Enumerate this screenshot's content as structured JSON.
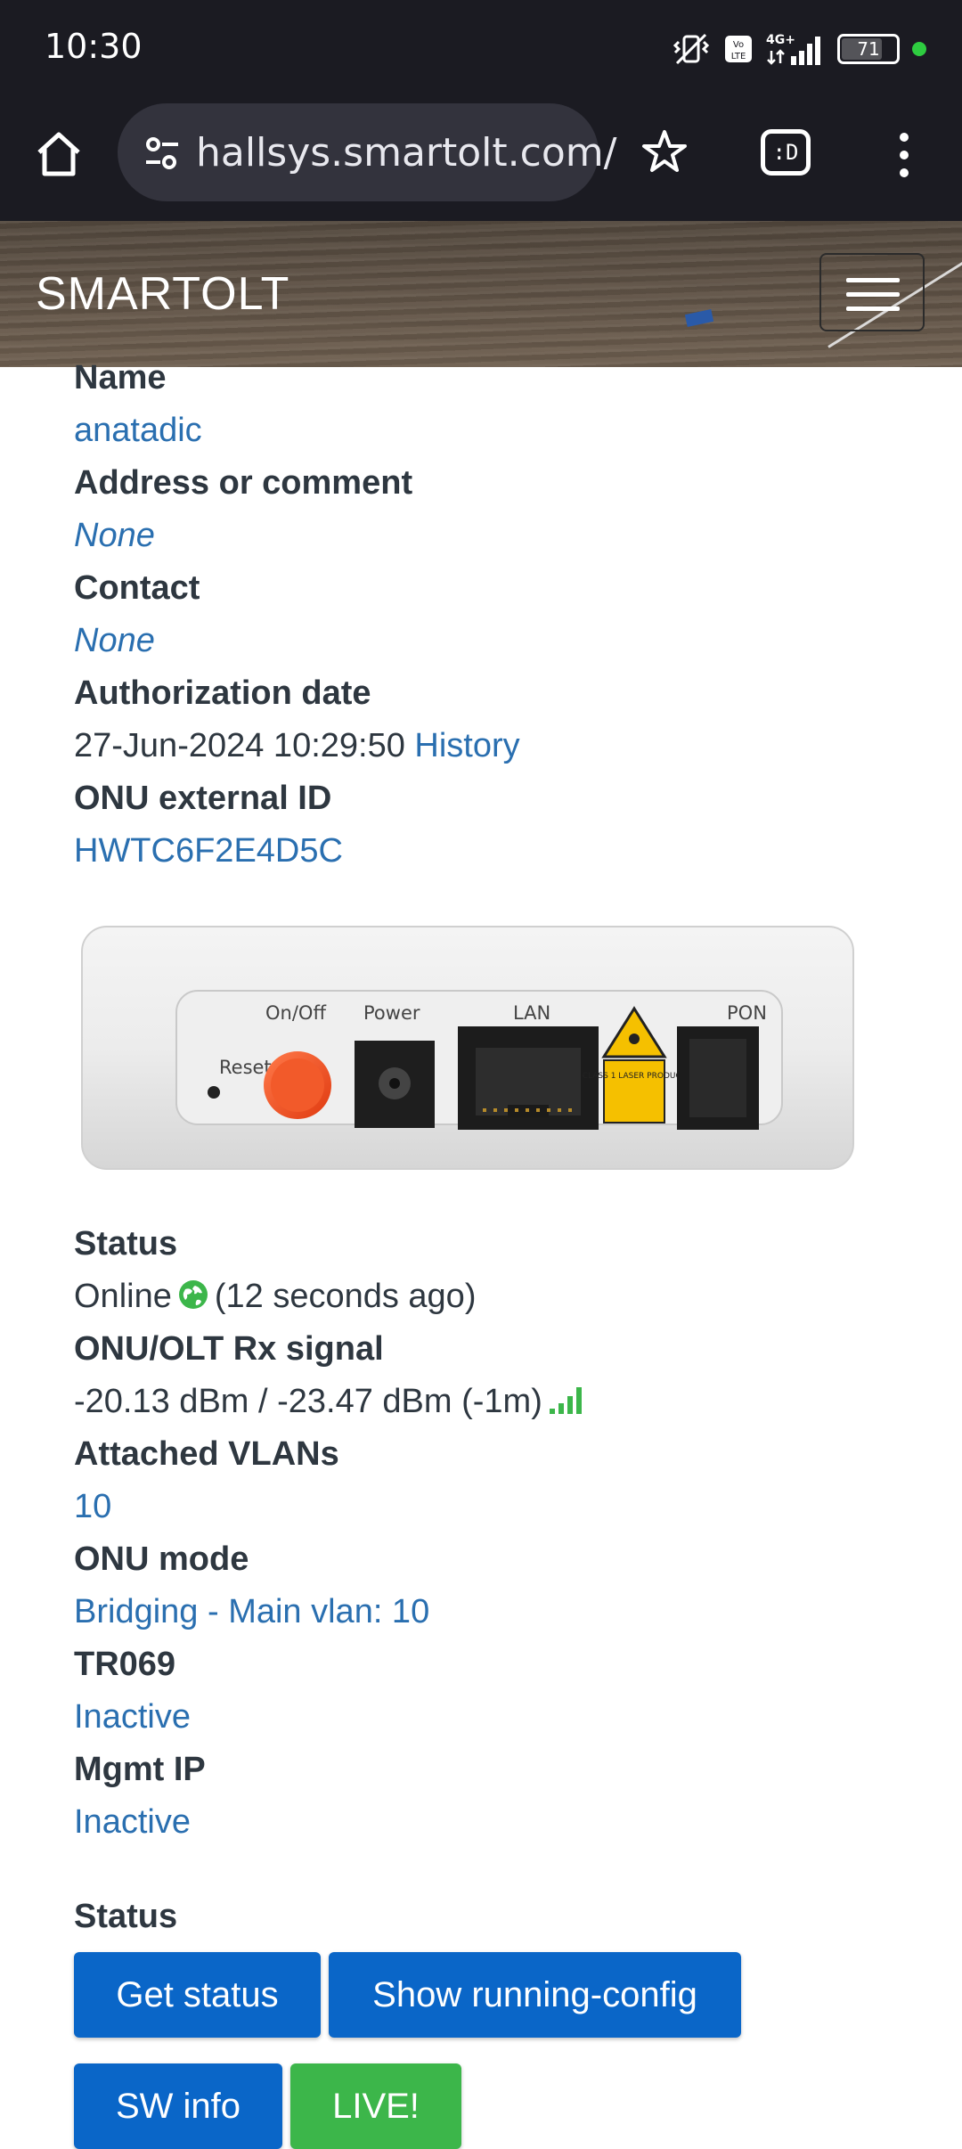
{
  "status_bar": {
    "time": "10:30",
    "battery": "71",
    "network": "4G+"
  },
  "browser": {
    "url": "hallsys.smartolt.com/",
    "tabs_label": ":D"
  },
  "header": {
    "brand": "SMARTOLT"
  },
  "fields": [
    {
      "label": "Name",
      "value": "anatadic"
    },
    {
      "label": "Address or comment",
      "value": "None"
    },
    {
      "label": "Contact",
      "value": "None"
    },
    {
      "label": "Authorization date",
      "value": "27-Jun-2024 10:29:50",
      "link": "History"
    },
    {
      "label": "ONU external ID",
      "value": "HWTC6F2E4D5C"
    }
  ],
  "device_image": {
    "labels": {
      "reset": "Reset",
      "onoff": "On/Off",
      "power": "Power",
      "lan": "LAN",
      "pon": "PON",
      "laser": "CLASS 1 LASER PRODUCT"
    }
  },
  "status_fields": [
    {
      "label": "Status",
      "value": "Online",
      "suffix": "(12 seconds ago)"
    },
    {
      "label": "ONU/OLT Rx signal",
      "value": "-20.13 dBm / -23.47 dBm (-1m)"
    },
    {
      "label": "Attached VLANs",
      "value": "10"
    },
    {
      "label": "ONU mode",
      "value": "Bridging - Main vlan: 10"
    },
    {
      "label": "TR069",
      "value": "Inactive"
    },
    {
      "label": "Mgmt IP",
      "value": "Inactive"
    }
  ],
  "actions": {
    "heading": "Status",
    "get_status": "Get status",
    "show_running_config": "Show running-config",
    "sw_info": "SW info",
    "live": "LIVE!"
  },
  "colors": {
    "link": "#2a6fb0",
    "text": "#2e3740",
    "button_blue": "#0a66c8",
    "button_green": "#3cb64a",
    "online_green": "#3cb64a"
  }
}
